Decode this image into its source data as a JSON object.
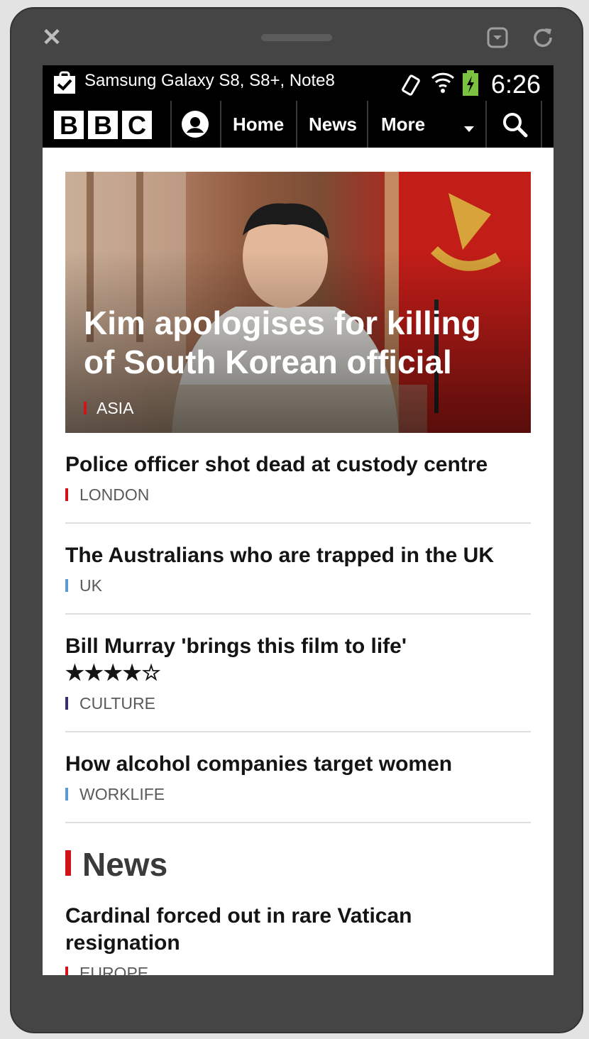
{
  "device": {
    "close_icon": "close-icon",
    "speaker": "speaker-grille",
    "icons": [
      "download-icon",
      "refresh-icon"
    ]
  },
  "statusbar": {
    "notification_text": "Samsung Galaxy S8, S8+, Note8",
    "time": "6:26",
    "icons": [
      "clipboard-check-icon",
      "vibrate-icon",
      "wifi-icon",
      "battery-charging-icon"
    ]
  },
  "nav": {
    "logo_letters": [
      "B",
      "B",
      "C"
    ],
    "account_icon": "account-icon",
    "home": "Home",
    "news": "News",
    "more": "More",
    "search_icon": "search-icon"
  },
  "hero": {
    "title": "Kim apologises for killing of South Korean official",
    "tag": "ASIA",
    "tag_color": "#d0141a"
  },
  "stories": [
    {
      "title": "Police officer shot dead at custody centre",
      "tag": "LONDON",
      "tag_color": "#d0141a"
    },
    {
      "title": "The Australians who are trapped in the UK",
      "tag": "UK",
      "tag_color": "#5a9bd5"
    },
    {
      "title": "Bill Murray 'brings this film to life' ★★★★☆",
      "tag": "CULTURE",
      "tag_color": "#3c2d6b"
    },
    {
      "title": "How alcohol companies target women",
      "tag": "WORKLIFE",
      "tag_color": "#5a9bd5"
    }
  ],
  "section": {
    "heading": "News",
    "story": {
      "title": "Cardinal forced out in rare Vatican resignation",
      "tag": "EUROPE",
      "tag_color": "#d0141a"
    }
  }
}
